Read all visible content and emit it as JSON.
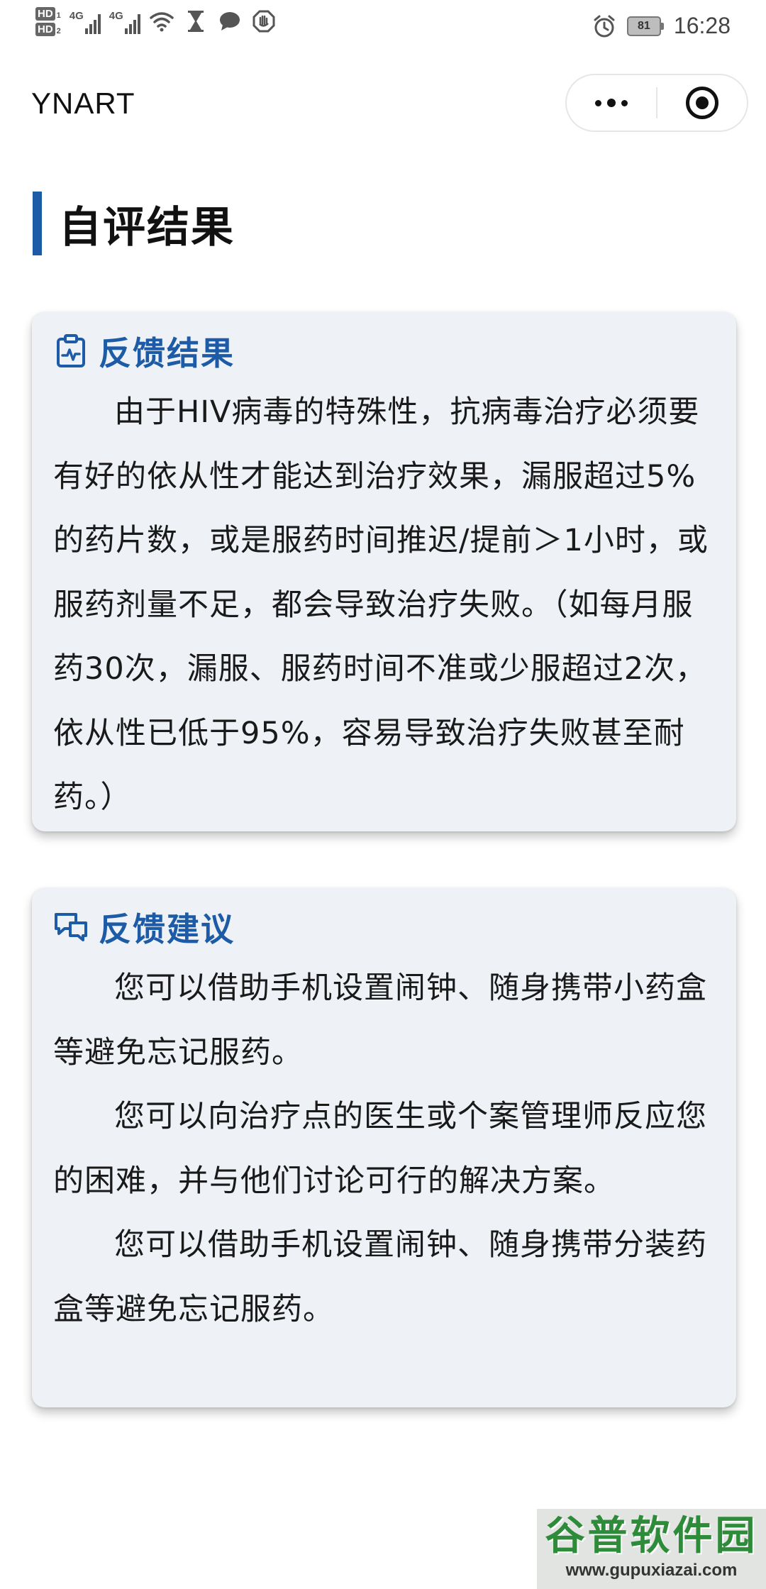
{
  "status_bar": {
    "hd1": "HD",
    "hd1_sub": "1",
    "hd2": "HD",
    "hd2_sub": "2",
    "network1": "4G",
    "network2": "4G",
    "icons": [
      "wifi-icon",
      "hourglass-icon",
      "chat-bubble-icon",
      "shield-hand-icon",
      "alarm-icon"
    ],
    "battery": "81",
    "time": "16:28"
  },
  "app": {
    "title": "YNART",
    "capsule_icons": [
      "more-dots-icon",
      "close-target-icon"
    ]
  },
  "page": {
    "heading": "自评结果",
    "accent_color": "#1d5ba6"
  },
  "feedback_result": {
    "icon": "clipboard-pulse-icon",
    "title": "反馈结果",
    "body": "由于HIV病毒的特殊性，抗病毒治疗必须要有好的依从性才能达到治疗效果，漏服超过5%的药片数，或是服药时间推迟/提前＞1小时，或服药剂量不足，都会导致治疗失败。（如每月服药30次，漏服、服药时间不准或少服超过2次，依从性已低于95%，容易导致治疗失败甚至耐药。）"
  },
  "feedback_advice": {
    "icon": "chat-bubbles-icon",
    "title": "反馈建议",
    "paragraphs": [
      "您可以借助手机设置闹钟、随身携带小药盒等避免忘记服药。",
      "您可以向治疗点的医生或个案管理师反应您的困难，并与他们讨论可行的解决方案。",
      "您可以借助手机设置闹钟、随身携带分装药盒等避免忘记服药。"
    ]
  },
  "watermark": {
    "main": "谷普软件园",
    "url": "www.gupuxiazai.com"
  }
}
